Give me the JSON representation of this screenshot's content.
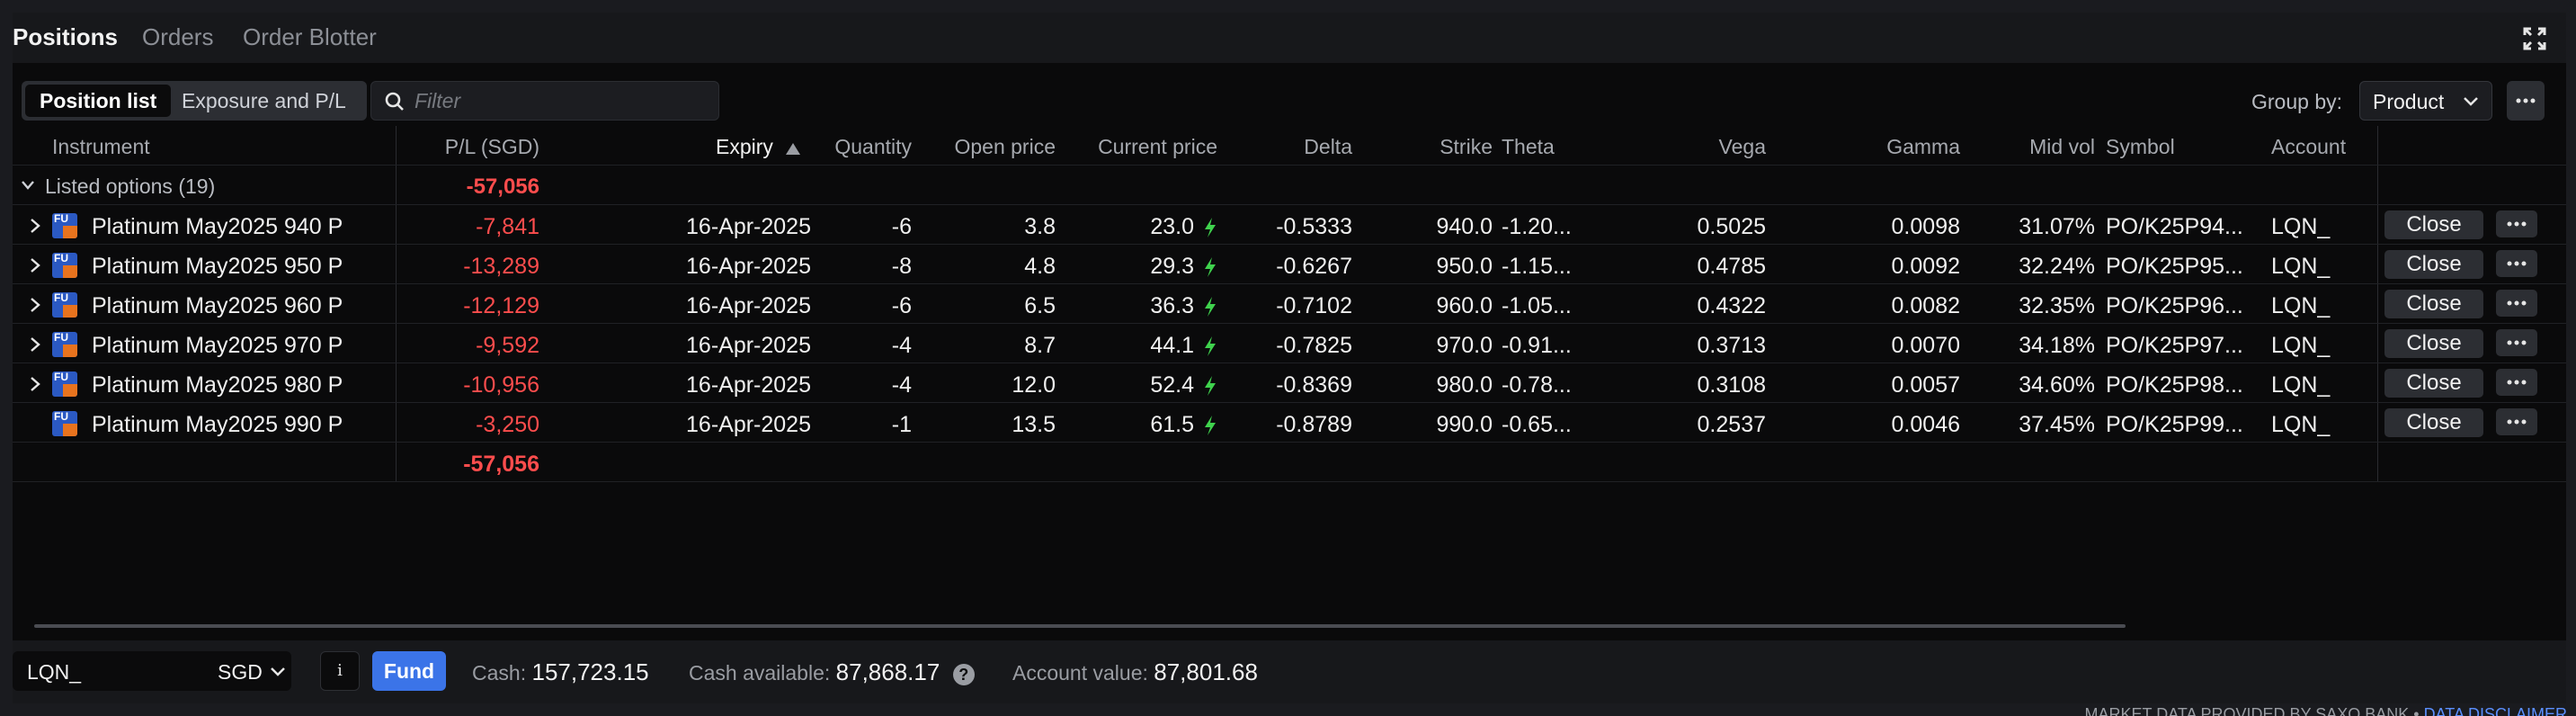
{
  "tabs": [
    {
      "label": "Positions",
      "active": true
    },
    {
      "label": "Orders",
      "active": false
    },
    {
      "label": "Order Blotter",
      "active": false
    }
  ],
  "toolbar": {
    "segments": [
      {
        "label": "Position list",
        "active": true
      },
      {
        "label": "Exposure and P/L",
        "active": false
      }
    ],
    "filter_placeholder": "Filter",
    "group_by_label": "Group by:",
    "group_by_value": "Product"
  },
  "columns": {
    "instrument": "Instrument",
    "pl": "P/L (SGD)",
    "expiry": "Expiry",
    "quantity": "Quantity",
    "open_price": "Open price",
    "current_price": "Current price",
    "delta": "Delta",
    "strike": "Strike",
    "theta": "Theta",
    "vega": "Vega",
    "gamma": "Gamma",
    "mid_vol": "Mid vol",
    "symbol": "Symbol",
    "account": "Account"
  },
  "sort": {
    "column": "expiry",
    "direction": "ascending"
  },
  "group": {
    "label": "Listed options (19)",
    "pl": "-57,056"
  },
  "rows": [
    {
      "instrument": "Platinum May2025 940 P",
      "pl": "-7,841",
      "expiry": "16-Apr-2025",
      "quantity": "-6",
      "open_price": "3.8",
      "current_price": "23.0",
      "delta": "-0.5333",
      "strike": "940.0",
      "theta": "-1.20...",
      "vega": "0.5025",
      "gamma": "0.0098",
      "mid_vol": "31.07%",
      "symbol": "PO/K25P94...",
      "account": "LQN_",
      "close_label": "Close",
      "expandable": true
    },
    {
      "instrument": "Platinum May2025 950 P",
      "pl": "-13,289",
      "expiry": "16-Apr-2025",
      "quantity": "-8",
      "open_price": "4.8",
      "current_price": "29.3",
      "delta": "-0.6267",
      "strike": "950.0",
      "theta": "-1.15...",
      "vega": "0.4785",
      "gamma": "0.0092",
      "mid_vol": "32.24%",
      "symbol": "PO/K25P95...",
      "account": "LQN_",
      "close_label": "Close",
      "expandable": true
    },
    {
      "instrument": "Platinum May2025 960 P",
      "pl": "-12,129",
      "expiry": "16-Apr-2025",
      "quantity": "-6",
      "open_price": "6.5",
      "current_price": "36.3",
      "delta": "-0.7102",
      "strike": "960.0",
      "theta": "-1.05...",
      "vega": "0.4322",
      "gamma": "0.0082",
      "mid_vol": "32.35%",
      "symbol": "PO/K25P96...",
      "account": "LQN_",
      "close_label": "Close",
      "expandable": true
    },
    {
      "instrument": "Platinum May2025 970 P",
      "pl": "-9,592",
      "expiry": "16-Apr-2025",
      "quantity": "-4",
      "open_price": "8.7",
      "current_price": "44.1",
      "delta": "-0.7825",
      "strike": "970.0",
      "theta": "-0.91...",
      "vega": "0.3713",
      "gamma": "0.0070",
      "mid_vol": "34.18%",
      "symbol": "PO/K25P97...",
      "account": "LQN_",
      "close_label": "Close",
      "expandable": true
    },
    {
      "instrument": "Platinum May2025 980 P",
      "pl": "-10,956",
      "expiry": "16-Apr-2025",
      "quantity": "-4",
      "open_price": "12.0",
      "current_price": "52.4",
      "delta": "-0.8369",
      "strike": "980.0",
      "theta": "-0.78...",
      "vega": "0.3108",
      "gamma": "0.0057",
      "mid_vol": "34.60%",
      "symbol": "PO/K25P98...",
      "account": "LQN_",
      "close_label": "Close",
      "expandable": true
    },
    {
      "instrument": "Platinum May2025 990 P",
      "pl": "-3,250",
      "expiry": "16-Apr-2025",
      "quantity": "-1",
      "open_price": "13.5",
      "current_price": "61.5",
      "delta": "-0.8789",
      "strike": "990.0",
      "theta": "-0.65...",
      "vega": "0.2537",
      "gamma": "0.0046",
      "mid_vol": "37.45%",
      "symbol": "PO/K25P99...",
      "account": "LQN_",
      "close_label": "Close",
      "expandable": false
    }
  ],
  "total_pl": "-57,056",
  "product_icon_text": "FU",
  "footer": {
    "account": "LQN_",
    "currency": "SGD",
    "info_label": "i",
    "fund_label": "Fund",
    "cash_label": "Cash:",
    "cash_value": "157,723.15",
    "cash_available_label": "Cash available:",
    "cash_available_value": "87,868.17",
    "help_label": "?",
    "account_value_label": "Account value:",
    "account_value": "87,801.68"
  },
  "disclaimer": {
    "text": "MARKET DATA PROVIDED BY SAXO BANK",
    "separator": "•",
    "link": "DATA DISCLAIMER"
  },
  "colors": {
    "negative": "#ff4d4d",
    "bolt": "#3fd24d",
    "fund": "#3b74e8",
    "product_icon_blue": "#2b59c3",
    "product_icon_orange": "#e8731e"
  }
}
